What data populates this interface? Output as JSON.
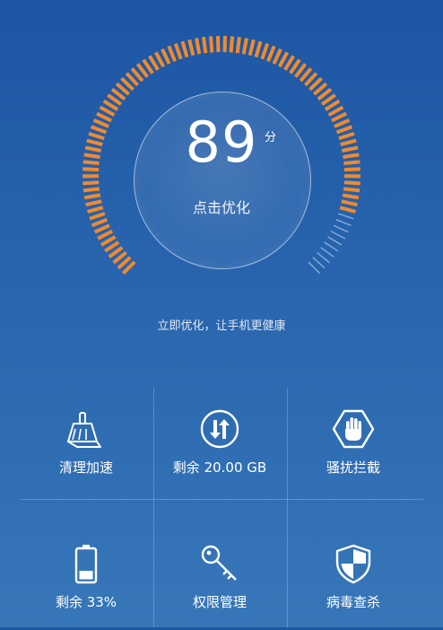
{
  "score": {
    "value": "89",
    "unit": "分",
    "action": "点击优化"
  },
  "gauge": {
    "fraction": 0.89,
    "active_color": "#f08a2e",
    "inactive_color": "#a9c4e6"
  },
  "tagline": "立即优化，让手机更健康",
  "features": [
    {
      "label": "清理加速",
      "icon": "broom-icon"
    },
    {
      "label": "剩余 20.00 GB",
      "icon": "transfer-arrows-icon"
    },
    {
      "label": "骚扰拦截",
      "icon": "hand-stop-icon"
    },
    {
      "label": "剩余 33%",
      "icon": "battery-icon"
    },
    {
      "label": "权限管理",
      "icon": "key-icon"
    },
    {
      "label": "病毒查杀",
      "icon": "shield-icon"
    }
  ],
  "colors": {
    "background_top": "#1d56a3",
    "background_bottom": "#3777b8",
    "text": "#ffffff"
  }
}
